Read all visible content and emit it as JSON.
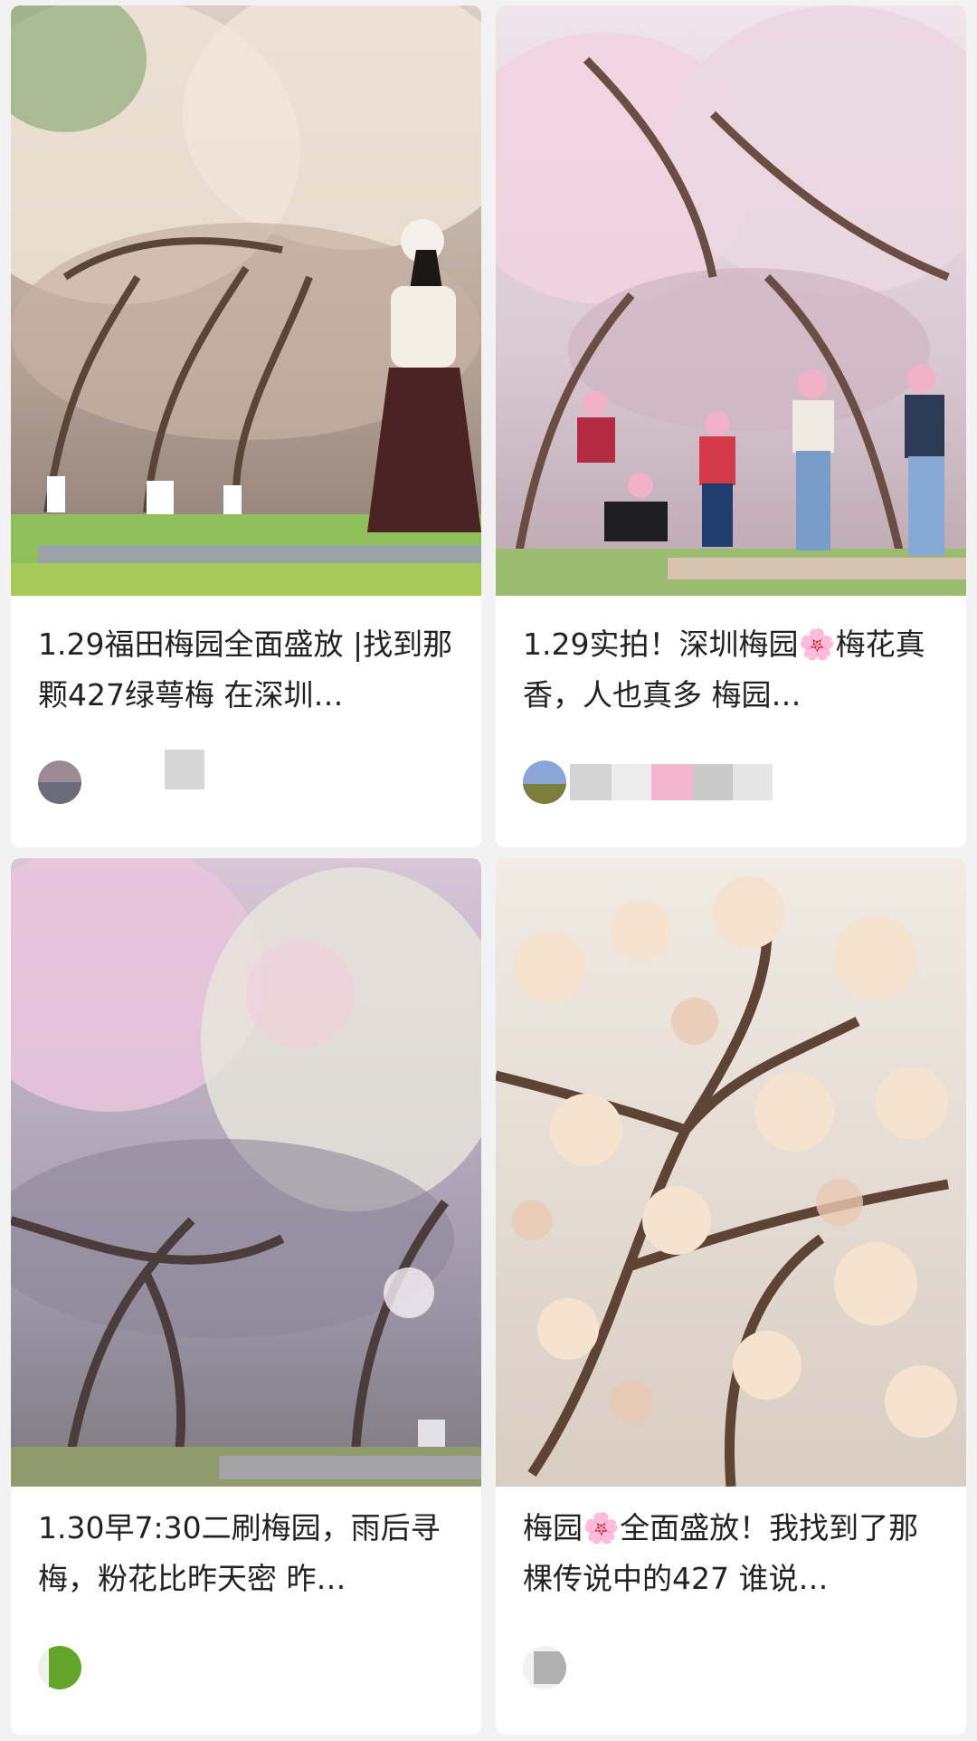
{
  "feed": {
    "cards": [
      {
        "title": "1.29福田梅园全面盛放 |找到那颗427绿萼梅 在深圳…",
        "image": "woman-in-white-under-plum-blossoms",
        "author_blurred": true
      },
      {
        "title": "1.29实拍！深圳梅园🌸梅花真香，人也真多 梅园…",
        "image": "crowd-taking-photos-in-plum-garden",
        "author_blurred": true
      },
      {
        "title": "1.30早7:30二刷梅园，雨后寻梅，粉花比昨天密 昨…",
        "image": "misty-plum-orchard-pink-blossoms",
        "author_blurred": true
      },
      {
        "title": "梅园🌸全面盛放！我找到了那棵传说中的427 谁说…",
        "image": "closeup-white-plum-blossom-branches",
        "author_blurred": true
      }
    ]
  },
  "colors": {
    "background": "#f2f2f2",
    "card": "#ffffff",
    "title_text": "#222222"
  }
}
